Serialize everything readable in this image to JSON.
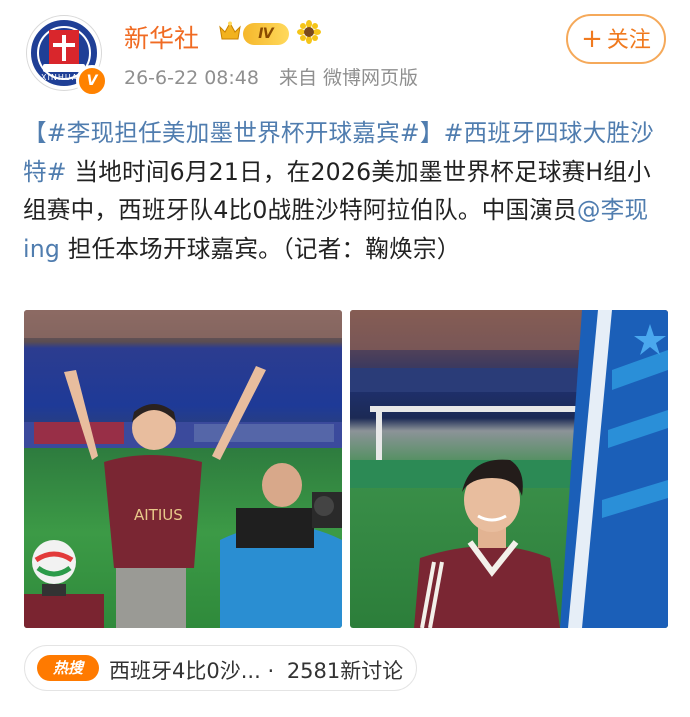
{
  "header": {
    "account_name": "新华社",
    "vip_level": "Ⅳ",
    "avatar_caption": "XINHUA",
    "verified_badge": "V",
    "timestamp": "26-6-22 08:48",
    "source": "来自 微博网页版",
    "follow_label": "关注",
    "follow_icon": "plus-icon"
  },
  "post": {
    "topic1": "【#李现担任美加墨世界杯开球嘉宾#】",
    "topic2": "#西班牙四球大胜沙特#",
    "text1": " 当地时间6月21日，在2026美加墨世界杯足球赛H组小组赛中，西班牙队4比0战胜沙特阿拉伯队。中国演员",
    "mention": "@李现ing",
    "text2": " 担任本场开球嘉宾。（记者：鞠焕宗）"
  },
  "photos": {
    "photo1_shirt_text": "AITIUS"
  },
  "hot": {
    "badge": "热搜",
    "title": "西班牙4比0沙...",
    "separator": "·",
    "count": "2581新讨论"
  },
  "colors": {
    "accent_orange": "#f06b23",
    "link_blue": "#507daf",
    "follow_border": "#f5a95a",
    "hot_badge": "#ff7a00"
  }
}
